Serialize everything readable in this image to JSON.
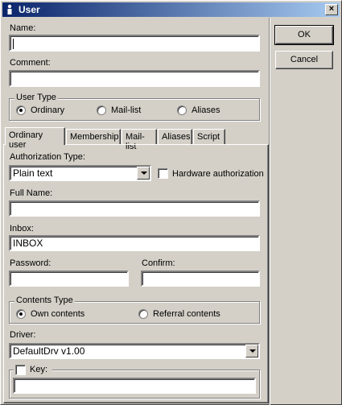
{
  "window": {
    "title": "User",
    "close_glyph": "×"
  },
  "fields": {
    "name_label": "Name:",
    "name_value": "",
    "comment_label": "Comment:",
    "comment_value": ""
  },
  "user_type": {
    "title": "User Type",
    "options": [
      "Ordinary",
      "Mail-list",
      "Aliases"
    ],
    "selected": "Ordinary"
  },
  "buttons": {
    "ok": "OK",
    "cancel": "Cancel"
  },
  "tabs": [
    "Ordinary user",
    "Membership",
    "Mail-list",
    "Aliases",
    "Script"
  ],
  "active_tab": "Ordinary user",
  "ordinary": {
    "auth_type_label": "Authorization Type:",
    "auth_type_value": "Plain text",
    "hardware_auth_label": "Hardware authorization",
    "hardware_auth_checked": false,
    "full_name_label": "Full Name:",
    "full_name_value": "",
    "inbox_label": "Inbox:",
    "inbox_value": "INBOX",
    "password_label": "Password:",
    "password_value": "",
    "confirm_label": "Confirm:",
    "confirm_value": "",
    "contents_type": {
      "title": "Contents Type",
      "options": [
        "Own contents",
        "Referral contents"
      ],
      "selected": "Own contents"
    },
    "driver_label": "Driver:",
    "driver_value": "DefaultDrv v1.00",
    "key_label": "Key:",
    "key_checked": false,
    "key_value": ""
  }
}
